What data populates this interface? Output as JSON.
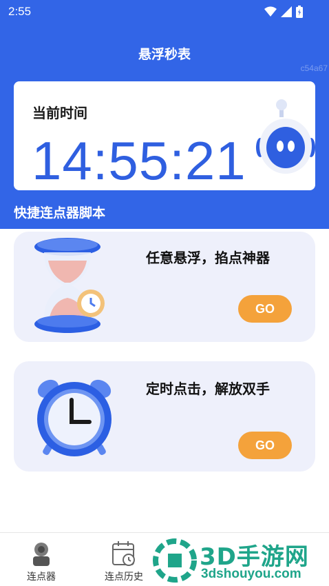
{
  "status_bar": {
    "time": "2:55",
    "icons": [
      "wifi-icon",
      "signal-icon",
      "battery-icon"
    ]
  },
  "header": {
    "title": "悬浮秒表",
    "device_id": "c54a67"
  },
  "clock": {
    "label": "当前时间",
    "value": "14:55:21"
  },
  "section_title": "快捷连点器脚本",
  "cards": [
    {
      "title": "任意悬浮，掐点神器",
      "button_label": "GO",
      "icon": "hourglass-icon"
    },
    {
      "title": "定时点击，解放双手",
      "button_label": "GO",
      "icon": "alarm-clock-icon"
    }
  ],
  "bottom_nav": {
    "items": [
      {
        "label": "连点器",
        "icon": "touch-icon"
      },
      {
        "label": "连点历史",
        "icon": "calendar-history-icon"
      }
    ]
  },
  "watermark": {
    "name": "3D手游网",
    "url": "3dshouyou.com"
  },
  "colors": {
    "primary": "#3265e7",
    "clock_text": "#2f5fe0",
    "button": "#f4a23b",
    "card_bg": "#eef0fb"
  }
}
